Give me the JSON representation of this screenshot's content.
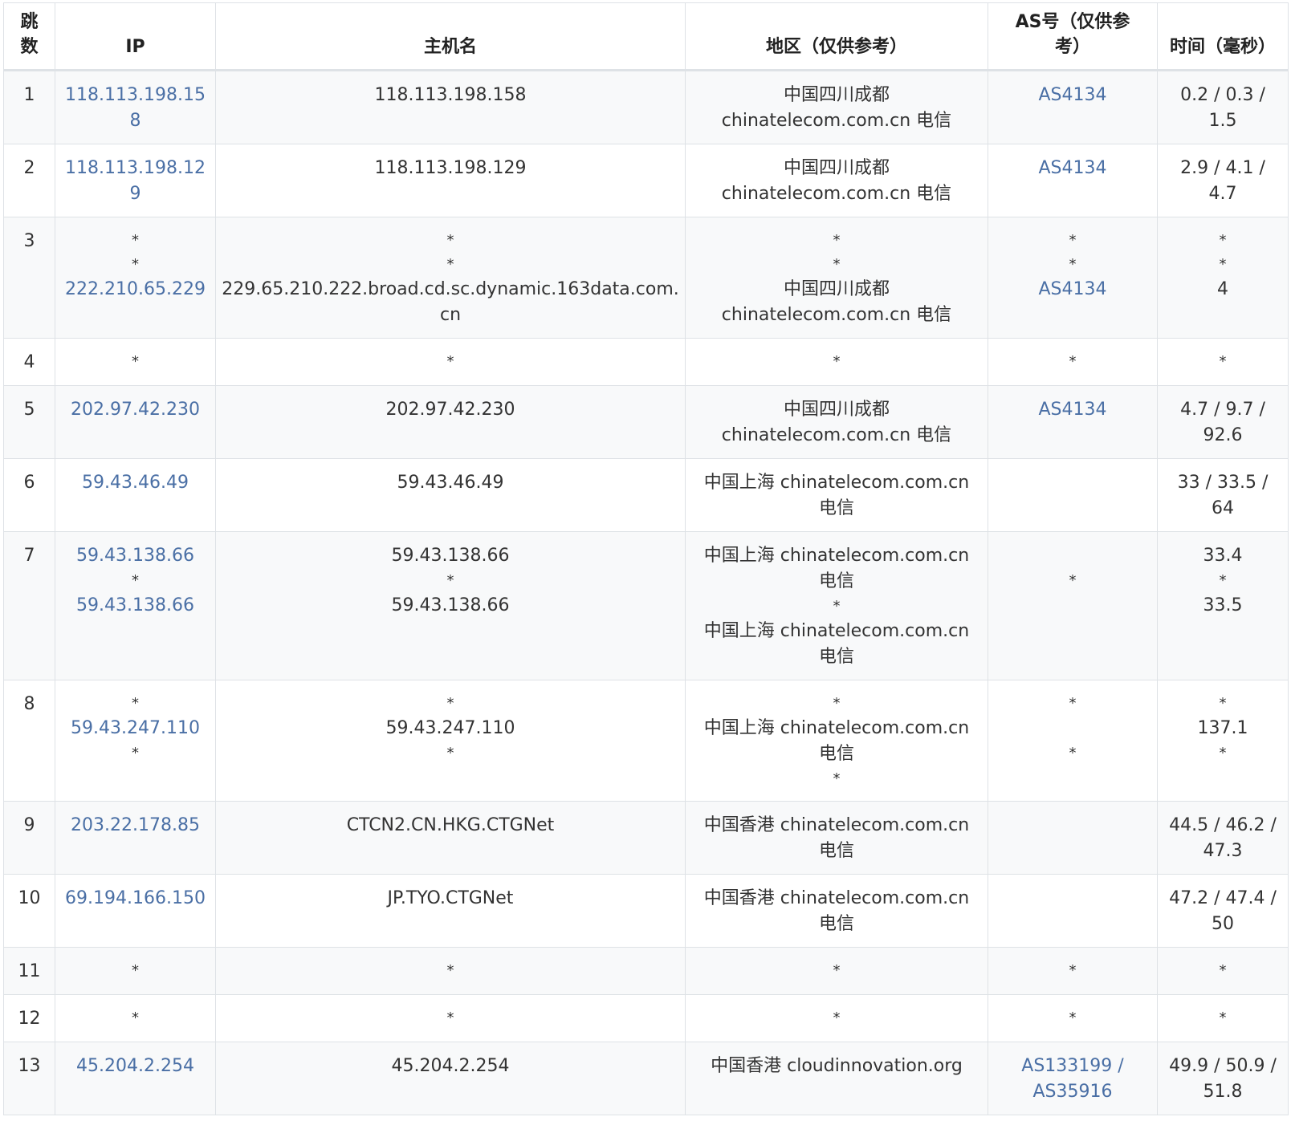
{
  "headers": {
    "hop": "跳数",
    "ip": "IP",
    "host": "主机名",
    "region": "地区（仅供参考）",
    "asn": "AS号（仅供参考）",
    "time": "时间（毫秒）"
  },
  "rows": [
    {
      "hop": "1",
      "ip": [
        "118.113.198.158"
      ],
      "host": [
        "118.113.198.158"
      ],
      "region": [
        "中国四川成都",
        "chinatelecom.com.cn 电信"
      ],
      "asn": [
        "AS4134"
      ],
      "time": [
        "0.2 / 0.3 /",
        "1.5"
      ]
    },
    {
      "hop": "2",
      "ip": [
        "118.113.198.129"
      ],
      "host": [
        "118.113.198.129"
      ],
      "region": [
        "中国四川成都",
        "chinatelecom.com.cn 电信"
      ],
      "asn": [
        "AS4134"
      ],
      "time": [
        "2.9 / 4.1 /",
        "4.7"
      ]
    },
    {
      "hop": "3",
      "ip": [
        "*",
        "*",
        "222.210.65.229"
      ],
      "host": [
        "*",
        "*",
        "229.65.210.222.broad.cd.sc.dynamic.163data.com.cn"
      ],
      "region": [
        "*",
        "*",
        "中国四川成都",
        "chinatelecom.com.cn 电信"
      ],
      "asn": [
        "*",
        "*",
        "AS4134"
      ],
      "time": [
        "*",
        "*",
        "4"
      ]
    },
    {
      "hop": "4",
      "ip": [
        "*"
      ],
      "host": [
        "*"
      ],
      "region": [
        "*"
      ],
      "asn": [
        "*"
      ],
      "time": [
        "*"
      ]
    },
    {
      "hop": "5",
      "ip": [
        "202.97.42.230"
      ],
      "host": [
        "202.97.42.230"
      ],
      "region": [
        "中国四川成都",
        "chinatelecom.com.cn 电信"
      ],
      "asn": [
        "AS4134"
      ],
      "time": [
        "4.7 / 9.7 /",
        "92.6"
      ]
    },
    {
      "hop": "6",
      "ip": [
        "59.43.46.49"
      ],
      "host": [
        "59.43.46.49"
      ],
      "region": [
        "中国上海 chinatelecom.com.cn",
        "电信"
      ],
      "asn": [],
      "time": [
        "33 / 33.5 /",
        "64"
      ]
    },
    {
      "hop": "7",
      "ip": [
        "59.43.138.66",
        "*",
        "59.43.138.66"
      ],
      "host": [
        "59.43.138.66",
        "*",
        "59.43.138.66"
      ],
      "region": [
        "中国上海 chinatelecom.com.cn",
        "电信",
        "*",
        "中国上海 chinatelecom.com.cn",
        "电信"
      ],
      "asn": [
        "",
        "*"
      ],
      "time": [
        "33.4",
        "*",
        "33.5"
      ]
    },
    {
      "hop": "8",
      "ip": [
        "*",
        "59.43.247.110",
        "*"
      ],
      "host": [
        "*",
        "59.43.247.110",
        "*"
      ],
      "region": [
        "*",
        "中国上海 chinatelecom.com.cn",
        "电信",
        "*"
      ],
      "asn": [
        "*",
        "",
        "*"
      ],
      "time": [
        "*",
        "137.1",
        "*"
      ]
    },
    {
      "hop": "9",
      "ip": [
        "203.22.178.85"
      ],
      "host": [
        "CTCN2.CN.HKG.CTGNet"
      ],
      "region": [
        "中国香港 chinatelecom.com.cn",
        "电信"
      ],
      "asn": [],
      "time": [
        "44.5 / 46.2 /",
        "47.3"
      ]
    },
    {
      "hop": "10",
      "ip": [
        "69.194.166.150"
      ],
      "host": [
        "JP.TYO.CTGNet"
      ],
      "region": [
        "中国香港 chinatelecom.com.cn",
        "电信"
      ],
      "asn": [],
      "time": [
        "47.2 / 47.4 /",
        "50"
      ]
    },
    {
      "hop": "11",
      "ip": [
        "*"
      ],
      "host": [
        "*"
      ],
      "region": [
        "*"
      ],
      "asn": [
        "*"
      ],
      "time": [
        "*"
      ]
    },
    {
      "hop": "12",
      "ip": [
        "*"
      ],
      "host": [
        "*"
      ],
      "region": [
        "*"
      ],
      "asn": [
        "*"
      ],
      "time": [
        "*"
      ]
    },
    {
      "hop": "13",
      "ip": [
        "45.204.2.254"
      ],
      "host": [
        "45.204.2.254"
      ],
      "region": [
        "中国香港 cloudinnovation.org"
      ],
      "asn": [
        "AS133199 /",
        "AS35916"
      ],
      "time": [
        "49.9 / 50.9 /",
        "51.8"
      ]
    }
  ],
  "colors": {
    "link": "#4a6fa5",
    "text": "#333333",
    "stripe": "#f8f9fa",
    "border": "#dee2e6"
  }
}
